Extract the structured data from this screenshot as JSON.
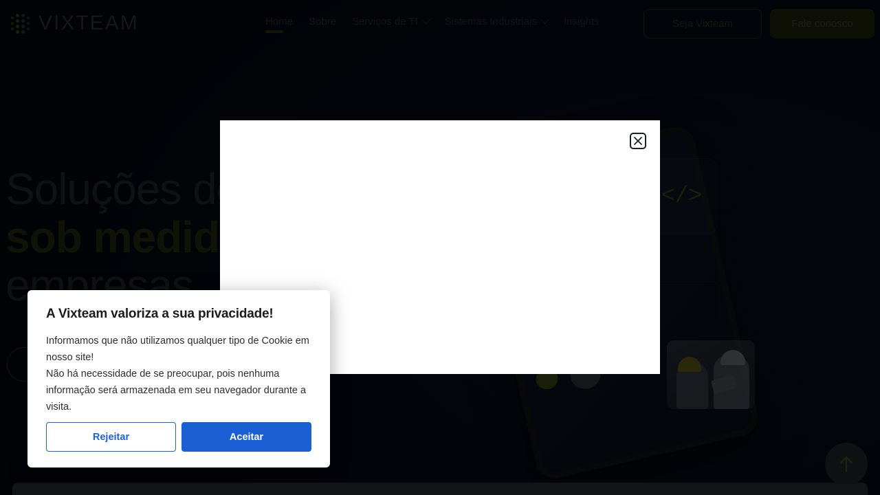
{
  "brand": {
    "name": "VIXTEAM",
    "logo_icon": "dot-matrix-icon",
    "accent_green": "#9aa81a",
    "dark_bg": "#05070e"
  },
  "header": {
    "nav": [
      {
        "label": "Home",
        "active": true,
        "has_dropdown": false
      },
      {
        "label": "Sobre",
        "active": false,
        "has_dropdown": false
      },
      {
        "label": "Serviços de TI",
        "active": false,
        "has_dropdown": true
      },
      {
        "label": "Sistemas Industriais",
        "active": false,
        "has_dropdown": true
      },
      {
        "label": "Insights",
        "active": false,
        "has_dropdown": false
      }
    ],
    "actions": {
      "secondary_label": "Seja Vixteam",
      "primary_label": "Fale conosco"
    }
  },
  "hero": {
    "line1": "Soluções de",
    "line2": "sob medida",
    "line3": "empresas",
    "cta_label": "",
    "art": {
      "code_icon": "</>",
      "photo_alt": "two-industrial-workers-photo"
    }
  },
  "white_modal": {
    "close_icon": "close-icon",
    "body_text": ""
  },
  "cookie_dialog": {
    "title": "A Vixteam valoriza a sua privacidade!",
    "paragraph1": "Informamos que não utilizamos qualquer tipo de Cookie em nosso site!",
    "paragraph2": "Não há necessidade de se preocupar, pois nenhuma informação será armazenada em seu navegador durante a visita.",
    "reject_label": "Rejeitar",
    "accept_label": "Aceitar",
    "accept_color": "#1a5fd4",
    "reject_color": "#1a62d6"
  },
  "scroll_top": {
    "icon": "arrow-up-icon"
  }
}
